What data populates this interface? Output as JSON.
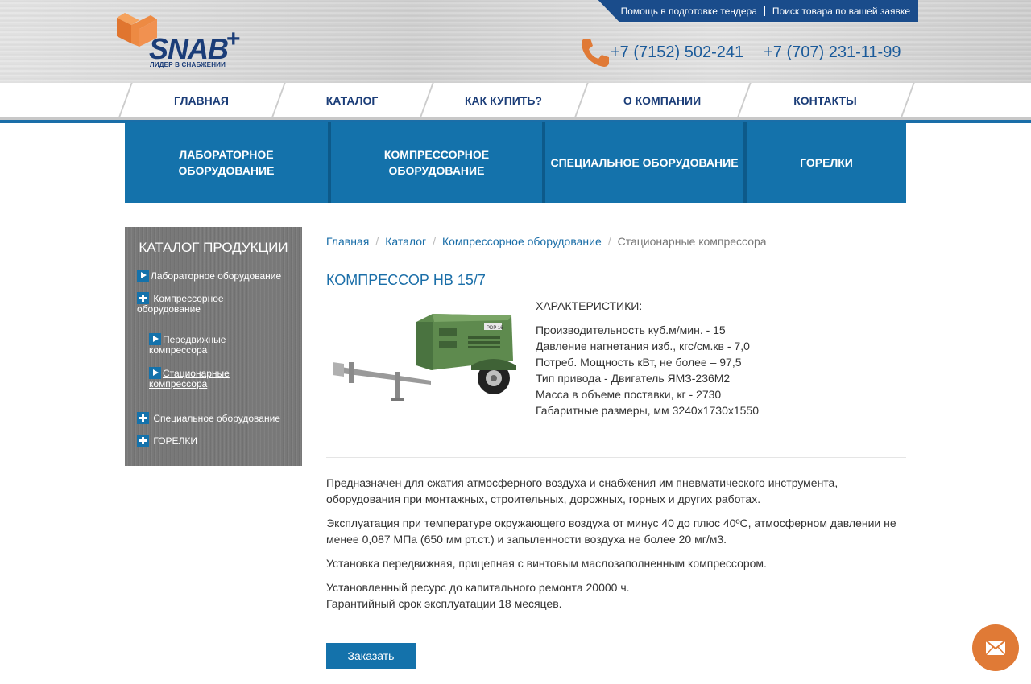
{
  "brand": {
    "logo_text": "SNAB",
    "logo_plus": "+",
    "tagline": "ЛИДЕР В СНАБЖЕНИИ"
  },
  "top_links": [
    "Помощь в подготовке тендера",
    "Поиск товара по вашей заявке"
  ],
  "phones": [
    "+7 (7152) 502-241",
    "+7 (707) 231-11-99"
  ],
  "nav": [
    "ГЛАВНАЯ",
    "КАТАЛОГ",
    "КАК КУПИТЬ?",
    "О КОМПАНИИ",
    "КОНТАКТЫ"
  ],
  "categories": [
    "ЛАБОРАТОРНОЕ ОБОРУДОВАНИЕ",
    "КОМПРЕССОРНОЕ ОБОРУДОВАНИЕ",
    "СПЕЦИАЛЬНОЕ ОБОРУДОВАНИЕ",
    "ГОРЕЛКИ"
  ],
  "sidebar": {
    "title": "КАТАЛОГ ПРОДУКЦИИ",
    "items": [
      {
        "label": "Лабораторное оборудование",
        "icon": "play-icon"
      },
      {
        "label": "Компрессорное оборудование",
        "icon": "plus-icon"
      },
      {
        "label": "Передвижные компрессора",
        "icon": "play-icon"
      },
      {
        "label": "Стационарные компрессора",
        "icon": "play-icon"
      },
      {
        "label": "Специальное оборудование",
        "icon": "plus-icon"
      },
      {
        "label": "ГОРЕЛКИ",
        "icon": "plus-icon"
      }
    ]
  },
  "breadcrumb": [
    "Главная",
    "Каталог",
    "Компрессорное оборудование",
    "Стационарные компрессора"
  ],
  "product": {
    "title": "КОМПРЕССОР НВ 15/7",
    "image_label": "PDP 16",
    "specs_title": "ХАРАКТЕРИСТИКИ:",
    "specs": [
      "Производительность куб.м/мин. - 15",
      "Давление нагнетания изб., кгс/см.кв - 7,0",
      "Потреб. Мощность кВт, не более – 97,5",
      "Тип привода - Двигатель ЯМЗ-236М2",
      "Масса в объеме поставки, кг - 2730",
      "Габаритные размеры, мм 3240х1730х1550"
    ],
    "description": [
      "Предназначен для сжатия атмосферного воздуха и снабжения им пневматического инструмента, оборудования при монтажных, строительных, дорожных, горных и других работах.",
      "Эксплуатация при температуре окружающего воздуха от минус 40 до плюс 40ºС, атмосферном давлении не менее 0,087 МПа (650 мм рт.ст.) и запыленности воздуха не более 20 мг/м3.",
      "Установка передвижная, прицепная с винтовым маслозаполненным компрессором.",
      "Установленный ресурс до капитального ремонта 20000 ч.",
      "Гарантийный срок эксплуатации 18 месяцев."
    ],
    "order_label": "Заказать"
  },
  "colors": {
    "brand_blue": "#1472ab",
    "dark_blue": "#1b3d78",
    "link_blue": "#1a6ea8",
    "accent_orange": "#e07a36"
  }
}
